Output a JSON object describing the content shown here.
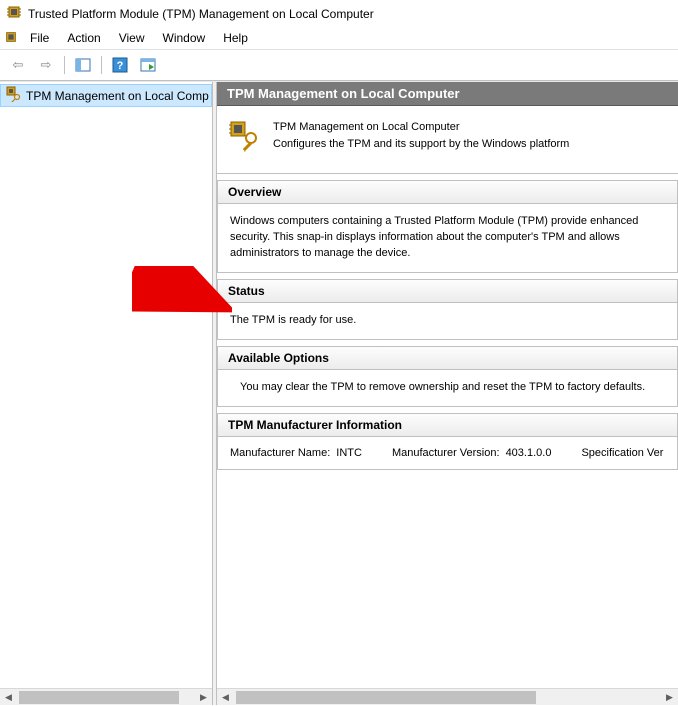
{
  "window": {
    "title": "Trusted Platform Module (TPM) Management on Local Computer"
  },
  "menu": {
    "file": "File",
    "action": "Action",
    "view": "View",
    "window": "Window",
    "help": "Help"
  },
  "toolbar": {
    "back": "back-icon",
    "forward": "forward-icon",
    "properties": "properties-icon",
    "help": "help-icon",
    "export": "export-icon"
  },
  "tree": {
    "root": "TPM Management on Local Comp"
  },
  "content": {
    "header": "TPM Management on Local Computer",
    "intro_title": "TPM Management on Local Computer",
    "intro_desc": "Configures the TPM and its support by the Windows platform",
    "sections": {
      "overview": {
        "title": "Overview",
        "body": "Windows computers containing a Trusted Platform Module (TPM) provide enhanced security. This snap-in displays information about the computer's TPM and allows administrators to manage the device."
      },
      "status": {
        "title": "Status",
        "body": "The TPM is ready for use."
      },
      "options": {
        "title": "Available Options",
        "body": "You may clear the TPM to remove ownership and reset the TPM to factory defaults."
      },
      "mfr": {
        "title": "TPM Manufacturer Information",
        "name_label": "Manufacturer Name:",
        "name_value": "INTC",
        "version_label": "Manufacturer Version:",
        "version_value": "403.1.0.0",
        "spec_label": "Specification Ver"
      }
    }
  }
}
